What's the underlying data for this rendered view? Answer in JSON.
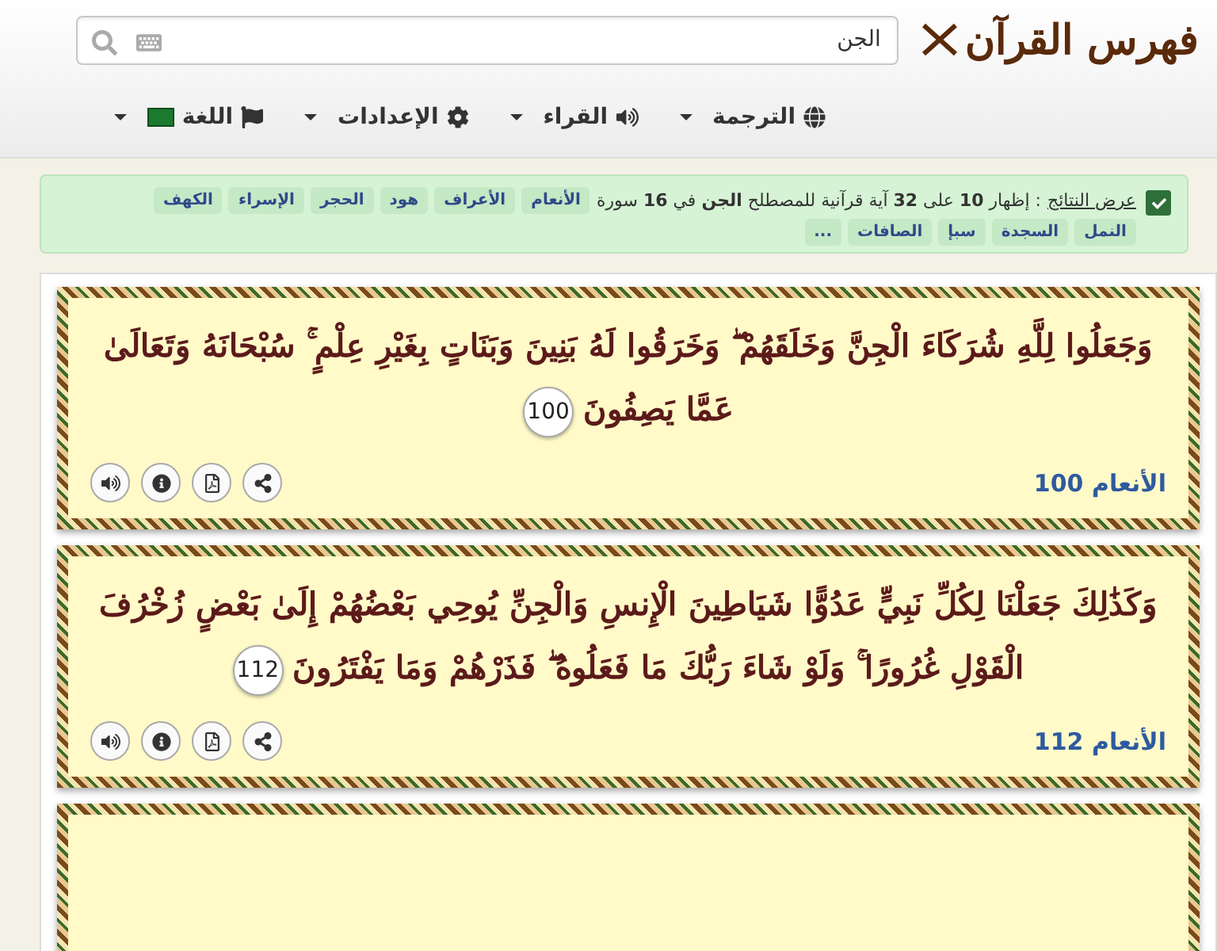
{
  "header": {
    "logo": "فهرس القرآن",
    "search": {
      "value": "الجن"
    }
  },
  "nav": [
    {
      "kind": "globe",
      "label": "الترجمة"
    },
    {
      "kind": "audio",
      "label": "القراء"
    },
    {
      "kind": "gear",
      "label": "الإعدادات"
    },
    {
      "kind": "flag",
      "label": "اللغة"
    }
  ],
  "results": {
    "checked": true,
    "link": "عرض النتائج",
    "summary": ": إظهار **10** على **32** آية قرآنية للمصطلح **الجن** في **16** سورة",
    "surahs": [
      "الأنعام",
      "الأعراف",
      "هود",
      "الحجر",
      "الإسراء",
      "الكهف",
      "النمل",
      "السجدة",
      "سبإ",
      "الصافات",
      "..."
    ]
  },
  "verses": [
    {
      "text": "وَجَعَلُوا لِلَّهِ شُرَكَاءَ الْجِنَّ وَخَلَقَهُمْ ۖ وَخَرَقُوا لَهُ بَنِينَ وَبَنَاتٍ بِغَيْرِ عِلْمٍ ۚ سُبْحَانَهُ وَتَعَالَىٰ عَمَّا يَصِفُونَ",
      "number": "100",
      "reference": "الأنعام 100"
    },
    {
      "text": "وَكَذَٰلِكَ جَعَلْنَا لِكُلِّ نَبِيٍّ عَدُوًّا شَيَاطِينَ الْإِنسِ وَالْجِنِّ يُوحِي بَعْضُهُمْ إِلَىٰ بَعْضٍ زُخْرُفَ الْقَوْلِ غُرُورًا ۚ وَلَوْ شَاءَ رَبُّكَ مَا فَعَلُوهُ ۖ فَذَرْهُمْ وَمَا يَفْتَرُونَ",
      "number": "112",
      "reference": "الأنعام 112"
    }
  ]
}
